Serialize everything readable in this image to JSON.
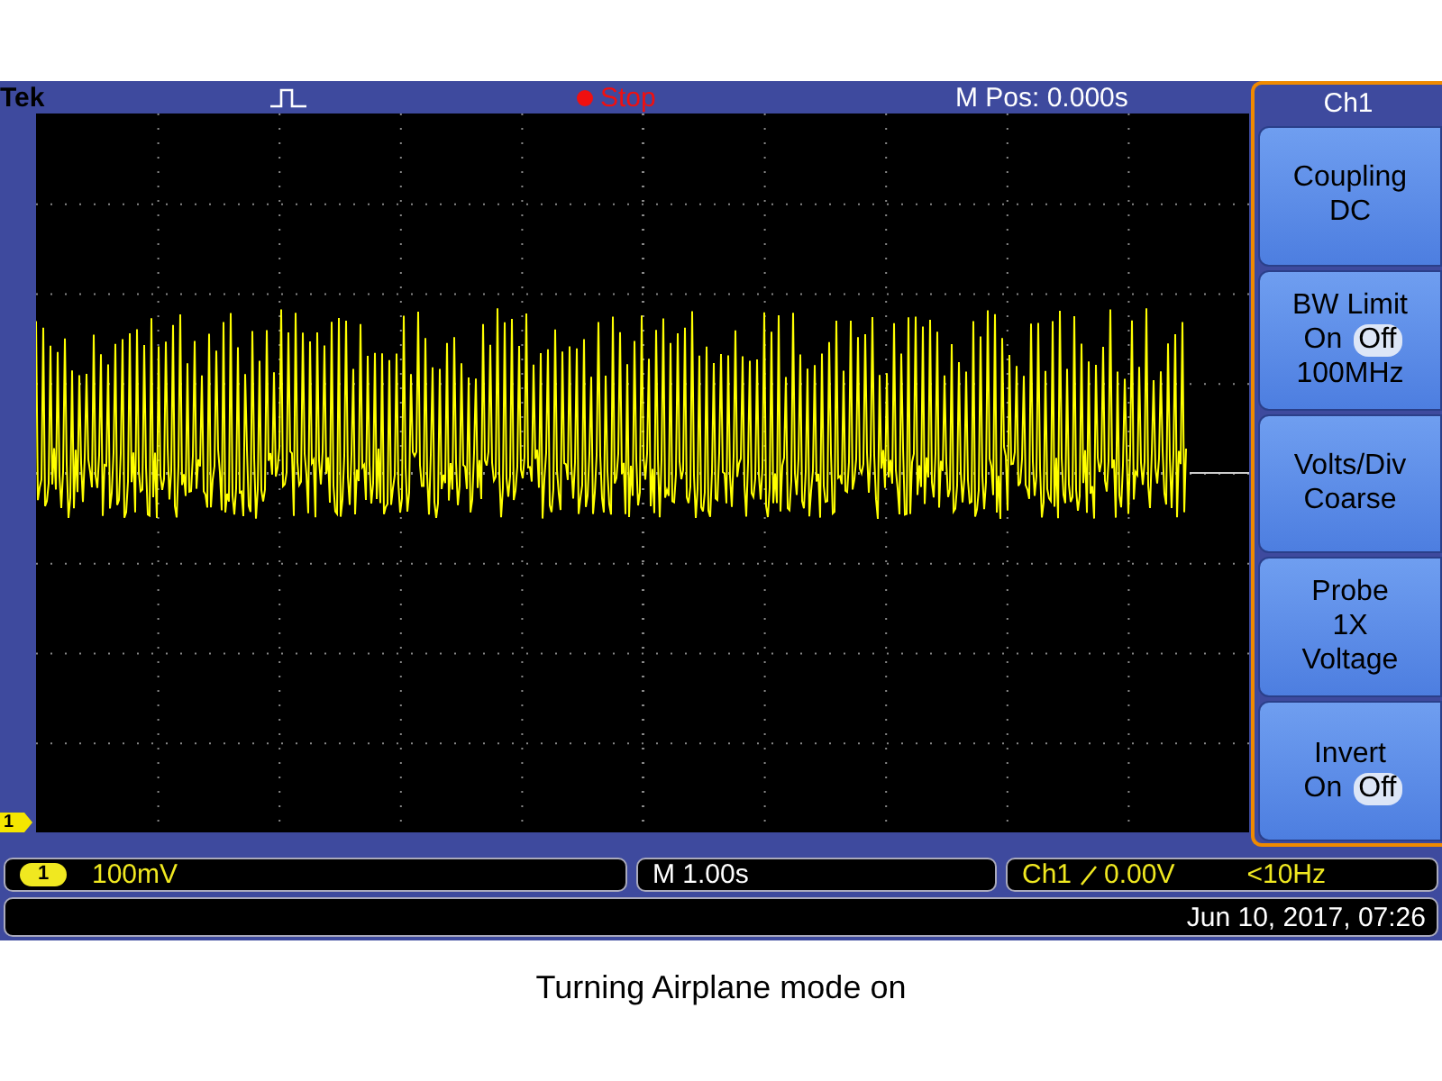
{
  "top_bar": {
    "brand": "Tek",
    "run_state": "Stop",
    "position": "M Pos: 0.000s"
  },
  "display": {
    "channel_marker": "1"
  },
  "side_menu": {
    "title": "Ch1",
    "buttons": [
      {
        "rows": [
          {
            "kind": "text",
            "text": "Coupling"
          },
          {
            "kind": "text",
            "text": "DC"
          }
        ]
      },
      {
        "rows": [
          {
            "kind": "text",
            "text": "BW Limit"
          },
          {
            "kind": "toggle",
            "options": [
              {
                "label": "On",
                "selected": false
              },
              {
                "label": "Off",
                "selected": true
              }
            ]
          },
          {
            "kind": "text",
            "text": "100MHz"
          }
        ]
      },
      {
        "rows": [
          {
            "kind": "text",
            "text": "Volts/Div"
          },
          {
            "kind": "text",
            "text": "Coarse"
          }
        ]
      },
      {
        "rows": [
          {
            "kind": "text",
            "text": "Probe"
          },
          {
            "kind": "text",
            "text": "1X"
          },
          {
            "kind": "text",
            "text": "Voltage"
          }
        ]
      },
      {
        "rows": [
          {
            "kind": "text",
            "text": "Invert"
          },
          {
            "kind": "toggle",
            "options": [
              {
                "label": "On",
                "selected": false
              },
              {
                "label": "Off",
                "selected": true
              }
            ]
          }
        ]
      }
    ]
  },
  "status_bar": {
    "channel_badge": "1",
    "scale": "100mV",
    "timebase": "M 1.00s",
    "trigger_source": "Ch1",
    "trigger_level": "0.00V",
    "frequency": "<10Hz",
    "datetime": "Jun 10, 2017, 07:26"
  },
  "caption": "Turning Airplane mode on"
}
